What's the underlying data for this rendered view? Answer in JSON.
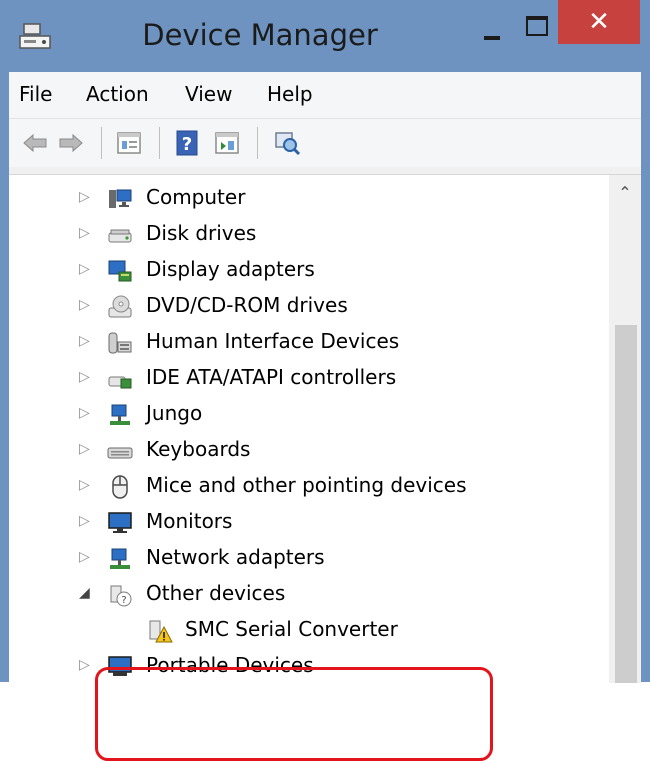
{
  "window": {
    "title": "Device Manager",
    "close_glyph": "✕"
  },
  "menu": {
    "items": [
      "File",
      "Action",
      "View",
      "Help"
    ]
  },
  "toolbar": {
    "icons": [
      "back-arrow-icon",
      "forward-arrow-icon",
      "properties-icon",
      "help-icon",
      "show-hidden-icon",
      "scan-hardware-icon"
    ]
  },
  "tree": {
    "nodes": [
      {
        "label": "Computer",
        "icon": "computer-icon",
        "expanded": false
      },
      {
        "label": "Disk drives",
        "icon": "disk-drive-icon",
        "expanded": false
      },
      {
        "label": "Display adapters",
        "icon": "display-adapter-icon",
        "expanded": false
      },
      {
        "label": "DVD/CD-ROM drives",
        "icon": "dvd-drive-icon",
        "expanded": false
      },
      {
        "label": "Human Interface Devices",
        "icon": "hid-icon",
        "expanded": false
      },
      {
        "label": "IDE ATA/ATAPI controllers",
        "icon": "ide-controller-icon",
        "expanded": false
      },
      {
        "label": "Jungo",
        "icon": "jungo-icon",
        "expanded": false
      },
      {
        "label": "Keyboards",
        "icon": "keyboard-icon",
        "expanded": false
      },
      {
        "label": "Mice and other pointing devices",
        "icon": "mouse-icon",
        "expanded": false
      },
      {
        "label": "Monitors",
        "icon": "monitor-icon",
        "expanded": false
      },
      {
        "label": "Network adapters",
        "icon": "network-adapter-icon",
        "expanded": false
      },
      {
        "label": "Other devices",
        "icon": "other-devices-icon",
        "expanded": true,
        "children": [
          {
            "label": "SMC Serial Converter",
            "icon": "warning-device-icon"
          }
        ]
      },
      {
        "label": "Portable Devices",
        "icon": "portable-device-icon",
        "expanded": false
      }
    ]
  },
  "colors": {
    "title_bar": "#6e93c1",
    "close_button": "#c7423e",
    "highlight": "#e3141b"
  }
}
